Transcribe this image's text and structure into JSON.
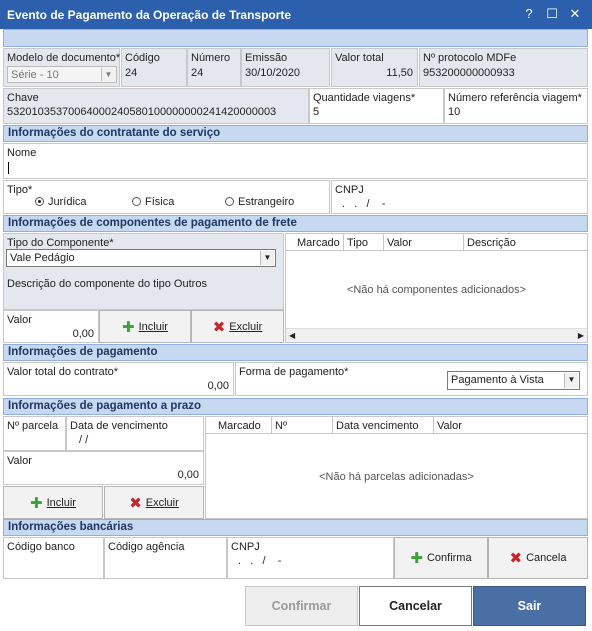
{
  "window": {
    "title": "Evento de Pagamento da Operação de Transporte",
    "help_glyph": "?",
    "max_glyph": "☐",
    "close_glyph": "✕"
  },
  "documento": {
    "modelo_label": "Modelo de documento*",
    "modelo_value": "Série - 10",
    "codigo_label": "Código",
    "codigo_value": "24",
    "numero_label": "Número",
    "numero_value": "24",
    "emissao_label": "Emissão",
    "emissao_value": "30/10/2020",
    "valor_total_label": "Valor total",
    "valor_total_value": "11,50",
    "protocolo_label": "Nº protocolo MDFe",
    "protocolo_value": "953200000000933",
    "chave_label": "Chave",
    "chave_value": "53201035370064000240580100000000241420000003",
    "qtd_viagens_label": "Quantidade viagens*",
    "qtd_viagens_value": "5",
    "num_ref_viagem_label": "Número referência viagem*",
    "num_ref_viagem_value": "10"
  },
  "contratante": {
    "section_title": "Informações do contratante do serviço",
    "nome_label": "Nome",
    "nome_value": "",
    "tipo_label": "Tipo*",
    "options": [
      "Jurídica",
      "Física",
      "Estrangeiro"
    ],
    "selected": "Jurídica",
    "cnpj_label": "CNPJ",
    "cnpj_mask": ".   .   /    -"
  },
  "componentes": {
    "section_title": "Informações de componentes de pagamento de frete",
    "tipo_label": "Tipo do Componente*",
    "tipo_value": "Vale Pedágio",
    "descricao_label": "Descrição do componente do tipo Outros",
    "valor_label": "Valor",
    "valor_value": "0,00",
    "incluir_label": "Incluir",
    "excluir_label": "Excluir",
    "columns": [
      "Marcado",
      "Tipo",
      "Valor",
      "Descrição"
    ],
    "empty_text": "<Não há componentes adicionados>"
  },
  "pagamento": {
    "section_title": "Informações de pagamento",
    "valor_total_label": "Valor total do contrato*",
    "valor_total_value": "0,00",
    "forma_label": "Forma de pagamento*",
    "forma_value": "Pagamento à Vista"
  },
  "prazo": {
    "section_title": "Informações de pagamento a prazo",
    "parcela_label": "Nº parcela",
    "vencimento_label": "Data de vencimento",
    "vencimento_mask": "/ /",
    "valor_label": "Valor",
    "valor_value": "0,00",
    "incluir_label": "Incluir",
    "excluir_label": "Excluir",
    "columns": [
      "Marcado",
      "Nº",
      "Data vencimento",
      "Valor"
    ],
    "empty_text": "<Não há parcelas adicionadas>"
  },
  "bancarias": {
    "section_title": "Informações bancárias",
    "codigo_banco_label": "Código banco",
    "codigo_agencia_label": "Código agência",
    "cnpj_label": "CNPJ",
    "cnpj_mask": ".   .   /    -",
    "confirma_label": "Confirma",
    "cancela_label": "Cancela"
  },
  "footer": {
    "confirmar_label": "Confirmar",
    "cancelar_label": "Cancelar",
    "sair_label": "Sair"
  },
  "colors": {
    "title_bar": "#2c60ad",
    "section_band": "#c6d9f1",
    "sair_button": "#4a6fa5"
  }
}
